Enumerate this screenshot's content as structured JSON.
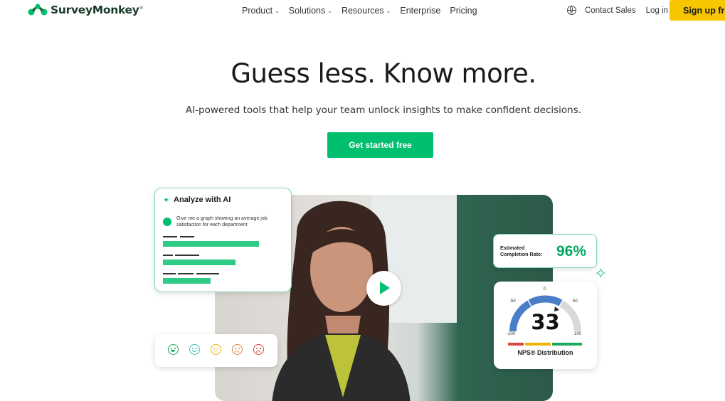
{
  "nav": {
    "logo_text": "SurveyMonkey",
    "menu": [
      {
        "label": "Product",
        "has_dropdown": true
      },
      {
        "label": "Solutions",
        "has_dropdown": true
      },
      {
        "label": "Resources",
        "has_dropdown": true
      },
      {
        "label": "Enterprise",
        "has_dropdown": false
      },
      {
        "label": "Pricing",
        "has_dropdown": false
      }
    ],
    "contact_label": "Contact Sales",
    "login_label": "Log in",
    "signup_label": "Sign up free"
  },
  "hero": {
    "headline": "Guess less. Know more.",
    "subheadline": "AI-powered tools that help your team unlock insights to make confident decisions.",
    "cta_label": "Get started free"
  },
  "ai_card": {
    "title": "Analyze with AI",
    "prompt": "Give me a graph showing an average job satisfaction for each department"
  },
  "completion_card": {
    "label": "Estimated Completion Rate:",
    "value": "96%"
  },
  "nps_card": {
    "score": "33",
    "label": "NPS® Distribution",
    "ticks": {
      "min": "-100",
      "neg50": "-50",
      "zero": "0",
      "pos50": "50",
      "max": "100"
    }
  },
  "colors": {
    "brand_green": "#00bf6f",
    "signup_yellow": "#f7c600",
    "accent_green_text": "#00a862"
  },
  "icons": [
    "logo-icon",
    "globe-icon",
    "play-icon",
    "sparkle-icon",
    "emoji-very-happy-icon",
    "emoji-happy-icon",
    "emoji-neutral-icon",
    "emoji-unhappy-icon",
    "emoji-angry-icon"
  ]
}
